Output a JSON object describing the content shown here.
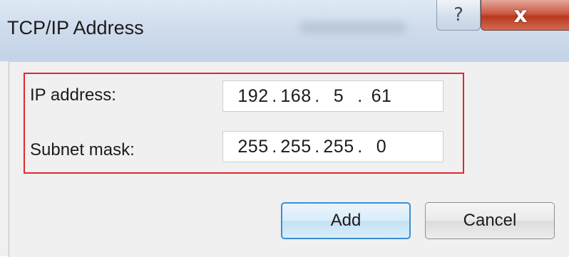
{
  "window": {
    "title": "TCP/IP Address",
    "help_glyph": "?",
    "close_glyph": "x"
  },
  "form": {
    "ip_label": "IP address:",
    "ip_octets": [
      "192",
      "168",
      "5",
      "61"
    ],
    "subnet_label": "Subnet mask:",
    "subnet_octets": [
      "255",
      "255",
      "255",
      "0"
    ]
  },
  "buttons": {
    "add_label": "Add",
    "cancel_label": "Cancel"
  },
  "colors": {
    "highlight": "#e0282e",
    "default_button_border": "#3c8ecf"
  }
}
